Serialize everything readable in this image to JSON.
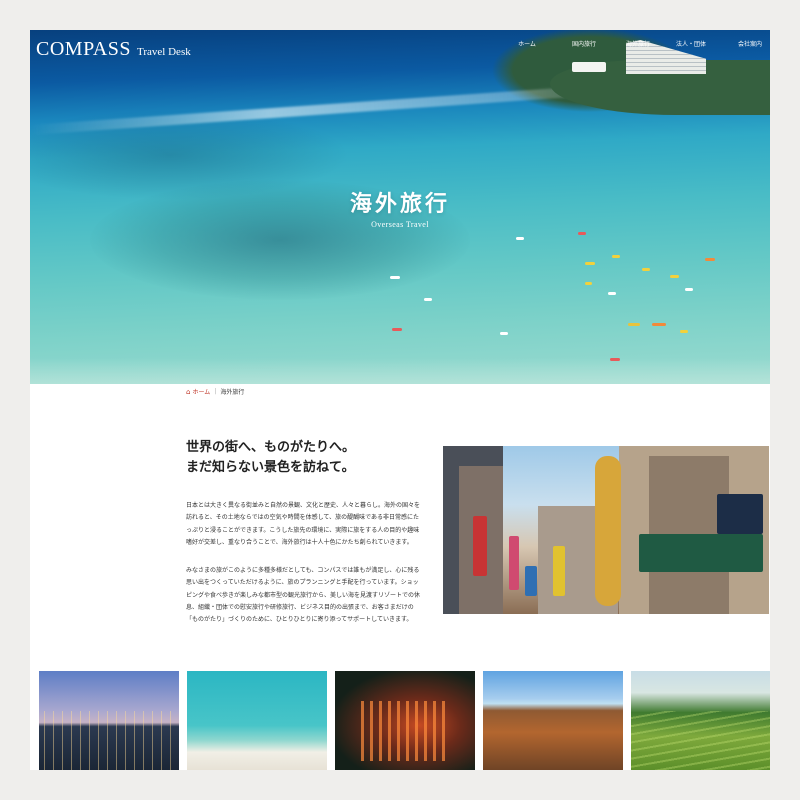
{
  "header": {
    "logo_main": "COMPASS",
    "logo_sub": "Travel Desk",
    "nav": [
      "ホーム",
      "国内旅行",
      "海外旅行",
      "法人・団体",
      "会社案内"
    ]
  },
  "hero": {
    "title": "海外旅行",
    "subtitle": "Overseas Travel"
  },
  "breadcrumb": {
    "home": "ホーム",
    "current": "海外旅行"
  },
  "intro": {
    "heading_line1": "世界の街へ、ものがたりへ。",
    "heading_line2": "まだ知らない景色を訪ねて。",
    "paragraph1": "日本とは大きく異なる街並みと自然の景観、文化と歴史、人々と暮らし。海外の国々を訪れると、その土地ならではの空気や時間を体感して、旅の醍醐味である非日常感にたっぷりと浸ることができます。こうした旅先の環境に、実際に旅をする人の目的や趣味嗜好が交差し、重なり合うことで、海外旅行は十人十色にかたち創られていきます。",
    "paragraph2": "みなさまの旅がこのように多種多様だとしても、コンパスでは誰もが満足し、心に残る思い出をつくっていただけるように、旅のプランニングと手配を行っています。ショッピングや食べ歩きが楽しみな都市型の観光旅行から、美しい海を見渡すリゾートでの休息、組織・団体での慰安旅行や研修旅行、ビジネス目的の出張まで、お客さまだけの「ものがたり」づくりのために、ひとりひとりに寄り添ってサポートしていきます。"
  },
  "icons": {
    "home": "home-icon"
  },
  "colors": {
    "accent": "#c0392b",
    "text": "#333333"
  }
}
